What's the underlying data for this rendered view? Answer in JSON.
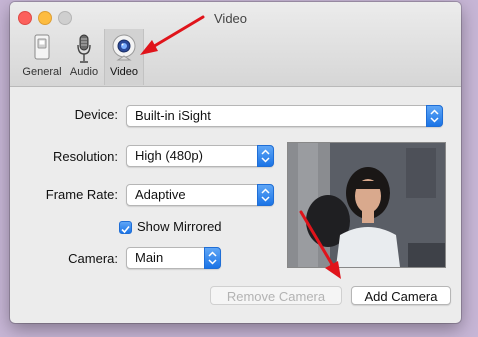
{
  "window": {
    "title": "Video"
  },
  "toolbar": {
    "items": [
      {
        "label": "General",
        "icon": "switch-icon"
      },
      {
        "label": "Audio",
        "icon": "microphone-icon"
      },
      {
        "label": "Video",
        "icon": "webcam-icon",
        "selected": true
      }
    ]
  },
  "form": {
    "device": {
      "label": "Device:",
      "value": "Built-in iSight"
    },
    "resolution": {
      "label": "Resolution:",
      "value": "High (480p)"
    },
    "frame_rate": {
      "label": "Frame Rate:",
      "value": "Adaptive"
    },
    "show_mirrored": {
      "label": "Show Mirrored",
      "checked": true
    },
    "camera": {
      "label": "Camera:",
      "value": "Main"
    }
  },
  "buttons": {
    "remove_camera": "Remove Camera",
    "add_camera": "Add Camera"
  },
  "colors": {
    "accent": "#1b74e6",
    "annotation_arrow": "#e0141b",
    "close": "#fc605c",
    "minimize": "#fdbc40"
  }
}
